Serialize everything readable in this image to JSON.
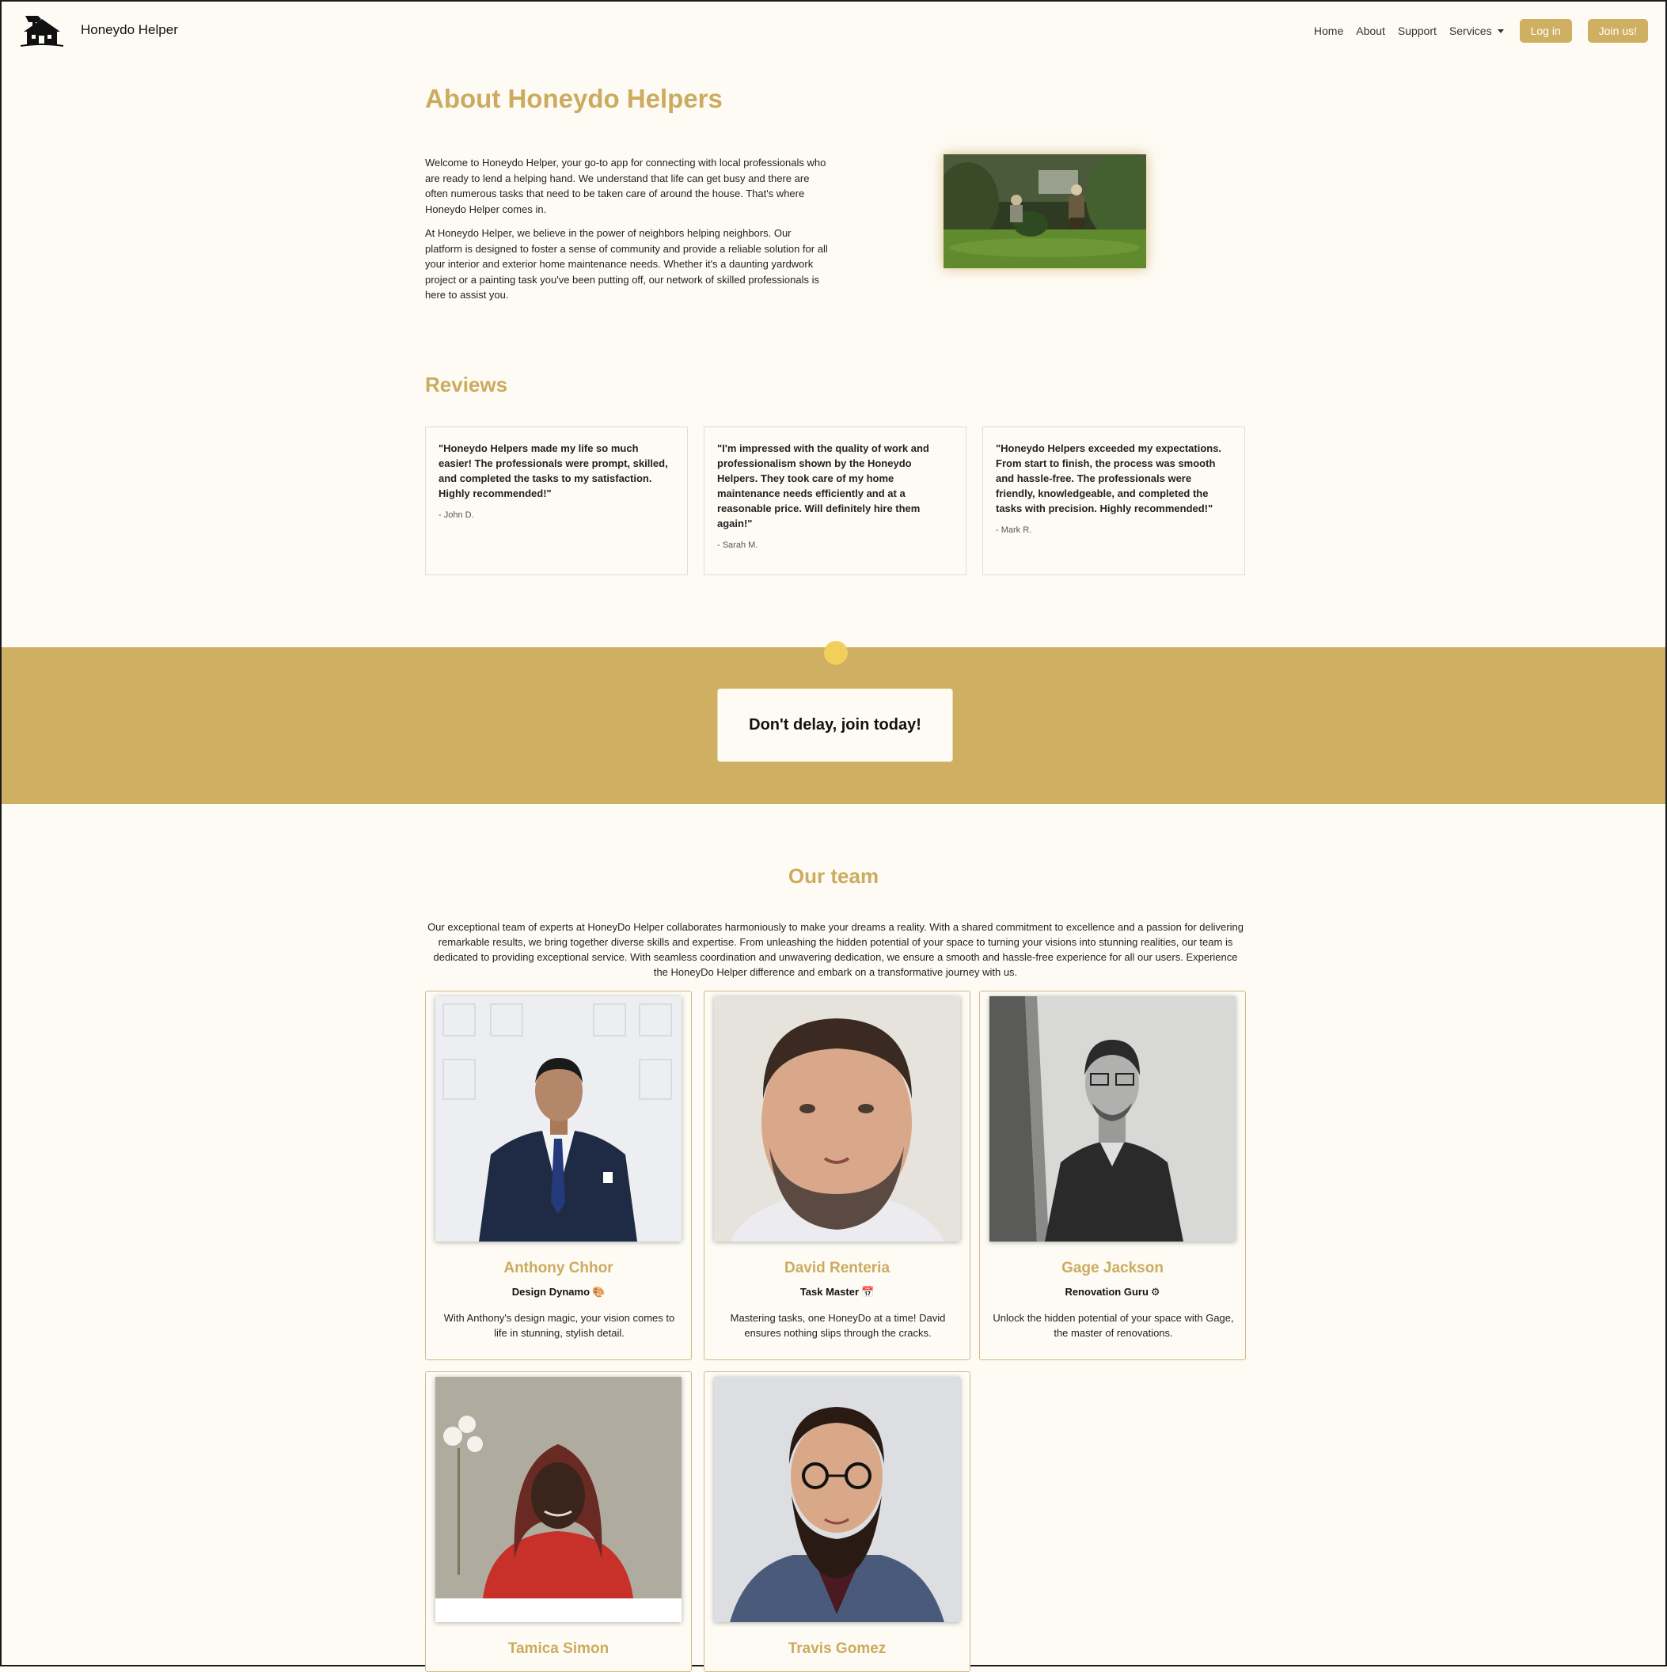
{
  "nav": {
    "brand": "Honeydo Helper",
    "links": [
      "Home",
      "About",
      "Support",
      "Services"
    ],
    "login": "Log in",
    "join": "Join us!"
  },
  "about": {
    "title": "About Honeydo Helpers",
    "paragraphs": [
      "Welcome to Honeydo Helper, your go-to app for connecting with local professionals who are ready to lend a helping hand. We understand that life can get busy and there are often numerous tasks that need to be taken care of around the house. That's where Honeydo Helper comes in.",
      "At Honeydo Helper, we believe in the power of neighbors helping neighbors. Our platform is designed to foster a sense of community and provide a reliable solution for all your interior and exterior home maintenance needs. Whether it's a daunting yardwork project or a painting task you've been putting off, our network of skilled professionals is here to assist you."
    ]
  },
  "reviews": {
    "title": "Reviews",
    "items": [
      {
        "quote": "\"Honeydo Helpers made my life so much easier! The professionals were prompt, skilled, and completed the tasks to my satisfaction. Highly recommended!\"",
        "author": "- John D."
      },
      {
        "quote": "\"I'm impressed with the quality of work and professionalism shown by the Honeydo Helpers. They took care of my home maintenance needs efficiently and at a reasonable price. Will definitely hire them again!\"",
        "author": "- Sarah M."
      },
      {
        "quote": "\"Honeydo Helpers exceeded my expectations. From start to finish, the process was smooth and hassle-free. The professionals were friendly, knowledgeable, and completed the tasks with precision. Highly recommended!\"",
        "author": "- Mark R."
      }
    ]
  },
  "banner": {
    "cta": "Don't delay, join today!"
  },
  "team": {
    "title": "Our team",
    "description": "Our exceptional team of experts at HoneyDo Helper collaborates harmoniously to make your dreams a reality. With a shared commitment to excellence and a passion for delivering remarkable results, we bring together diverse skills and expertise. From unleashing the hidden potential of your space to turning your visions into stunning realities, our team is dedicated to providing exceptional service. With seamless coordination and unwavering dedication, we ensure a smooth and hassle-free experience for all our users. Experience the HoneyDo Helper difference and embark on a transformative journey with us.",
    "members": [
      {
        "name": "Anthony Chhor",
        "role": "Design Dynamo",
        "role_icon": "🎨",
        "desc": "With Anthony's design magic, your vision comes to life in stunning, stylish detail."
      },
      {
        "name": "David Renteria",
        "role": "Task Master",
        "role_icon": "📅",
        "desc": "Mastering tasks, one HoneyDo at a time! David ensures nothing slips through the cracks."
      },
      {
        "name": "Gage Jackson",
        "role": "Renovation Guru",
        "role_icon": "⚙",
        "desc": "Unlock the hidden potential of your space with Gage, the master of renovations."
      },
      {
        "name": "Tamica Simon"
      },
      {
        "name": "Travis Gomez"
      }
    ]
  },
  "colors": {
    "accent": "#ccab5f",
    "banner": "#cfb062",
    "background": "#fdfbf4",
    "dot": "#f2cf5a"
  }
}
